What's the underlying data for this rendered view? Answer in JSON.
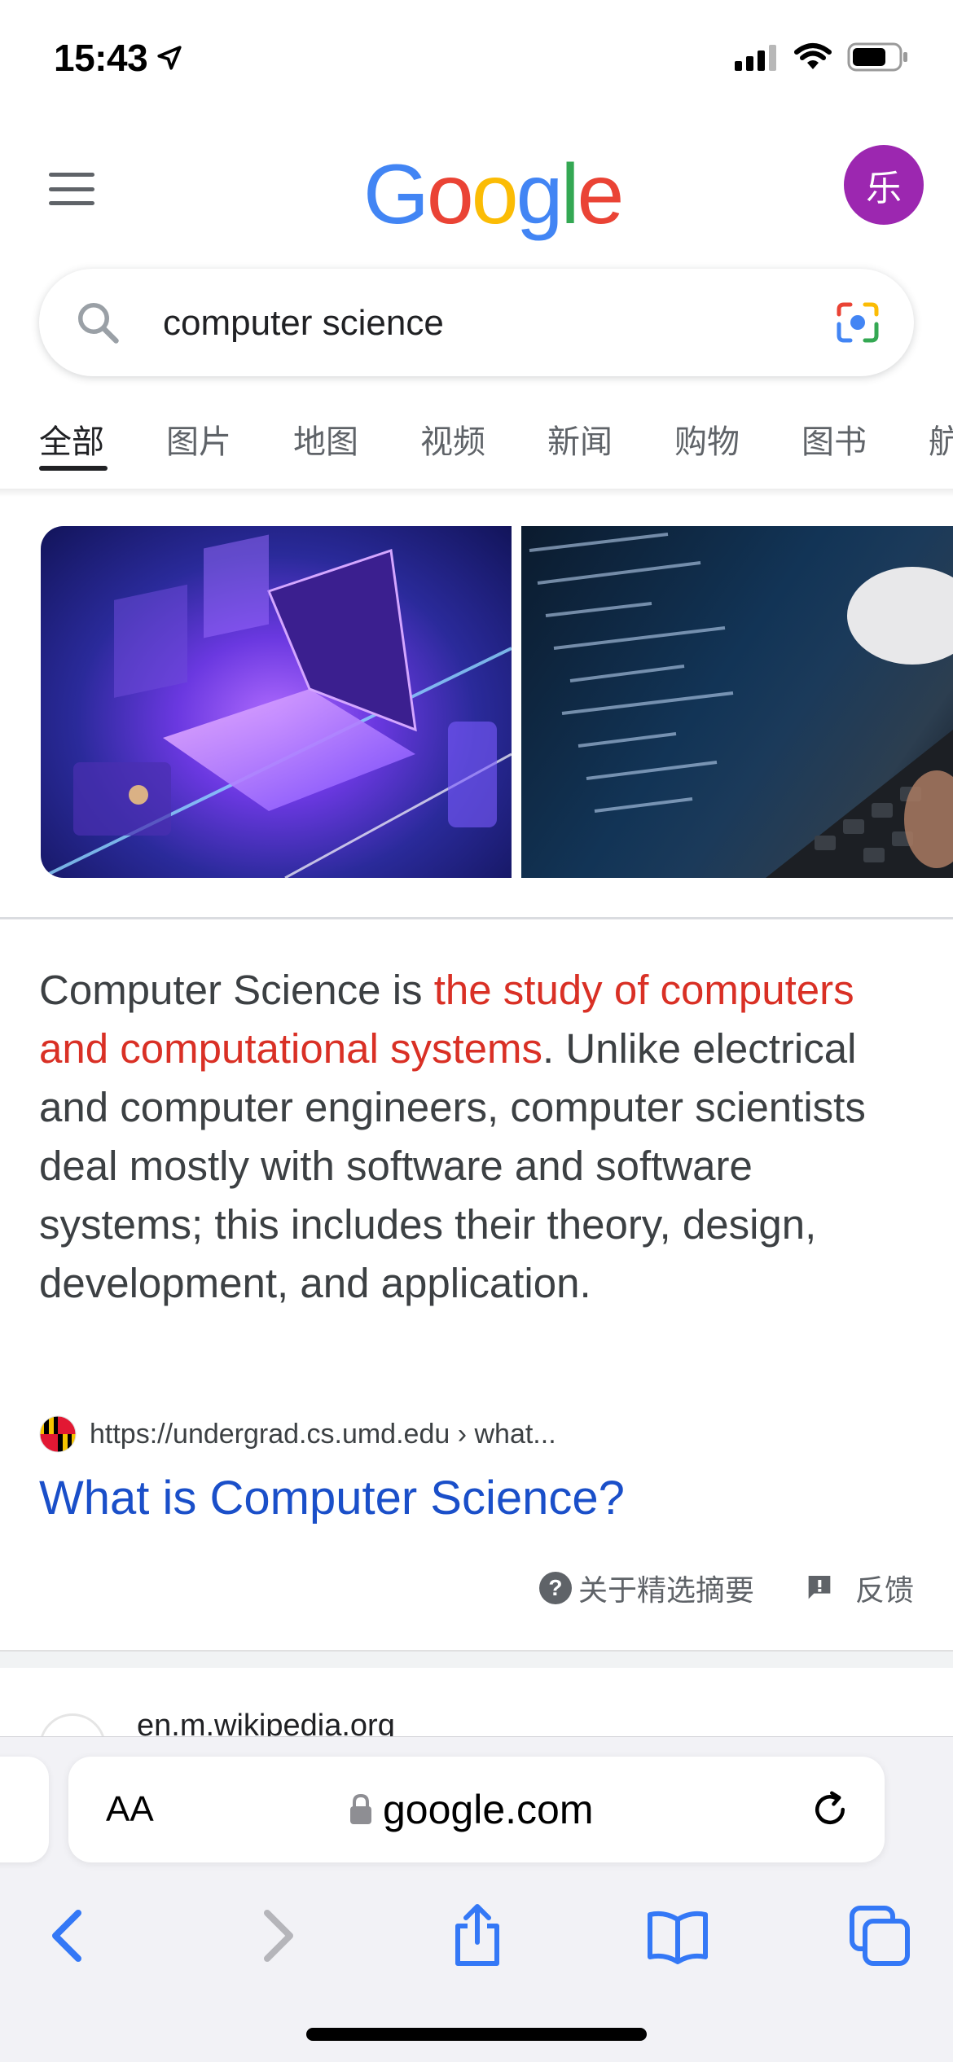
{
  "status_bar": {
    "time": "15:43",
    "icons": [
      "location-arrow-icon",
      "cellular-signal-icon",
      "wifi-icon",
      "battery-icon"
    ]
  },
  "header": {
    "menu_icon": "hamburger-menu-icon",
    "logo_letters": [
      "G",
      "o",
      "o",
      "g",
      "l",
      "e"
    ],
    "logo_colors": [
      "#4285F4",
      "#EA4335",
      "#FBBC05",
      "#4285F4",
      "#34A853",
      "#EA4335"
    ],
    "avatar_initial": "乐",
    "avatar_color": "#9C27B0"
  },
  "search": {
    "query": "computer science",
    "icons": [
      "search-icon",
      "google-lens-camera-icon"
    ]
  },
  "tabs": [
    {
      "label": "全部",
      "active": true
    },
    {
      "label": "图片",
      "active": false
    },
    {
      "label": "地图",
      "active": false
    },
    {
      "label": "视频",
      "active": false
    },
    {
      "label": "新闻",
      "active": false
    },
    {
      "label": "购物",
      "active": false
    },
    {
      "label": "图书",
      "active": false
    },
    {
      "label": "航",
      "active": false
    }
  ],
  "featured_snippet": {
    "images": [
      "laptop-illustration-image",
      "code-on-laptop-photo"
    ],
    "text_before": "Computer Science is ",
    "text_highlight": "the study of computers and computational systems",
    "text_after": ". Unlike electrical and computer engineers, computer scientists deal mostly with software and software systems; this includes their theory, design, development, and application.",
    "highlight_color": "#D93025",
    "source_url": "https://undergrad.cs.umd.edu › what...",
    "result_title": "What is Computer Science?",
    "about_label": "关于精选摘要",
    "feedback_label": "反馈"
  },
  "next_result": {
    "domain": "en.m.wikipedia.org"
  },
  "safari": {
    "text_size_label": "AA",
    "url": "google.com",
    "toolbar_icons": [
      "back-icon",
      "forward-icon",
      "share-icon",
      "bookmarks-icon",
      "tabs-icon"
    ],
    "accent_color": "#3478F6"
  }
}
